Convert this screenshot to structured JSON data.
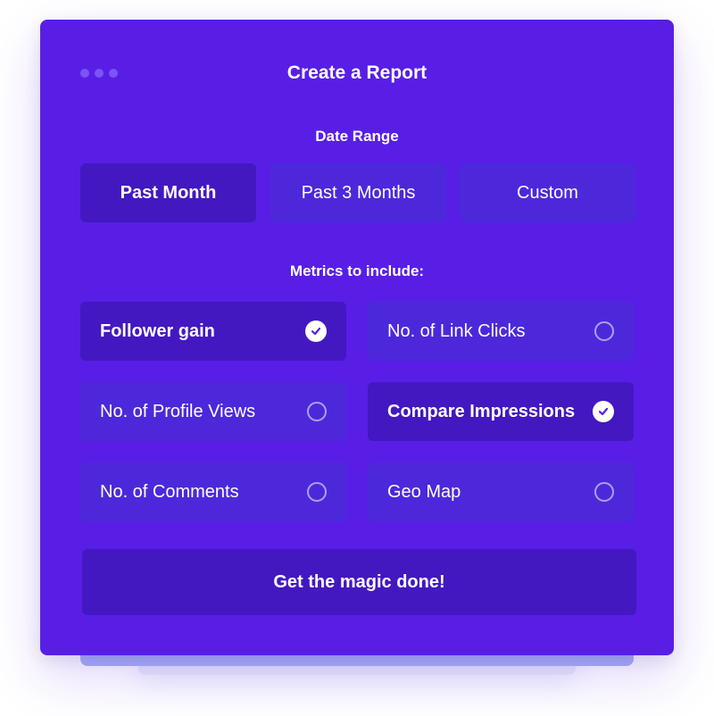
{
  "window": {
    "title": "Create a Report",
    "dots": 3
  },
  "date_range": {
    "label": "Date Range",
    "options": [
      {
        "label": "Past Month",
        "selected": true
      },
      {
        "label": "Past 3 Months",
        "selected": false
      },
      {
        "label": "Custom",
        "selected": false
      }
    ]
  },
  "metrics": {
    "label": "Metrics to include:",
    "items": [
      {
        "label": "Follower gain",
        "checked": true
      },
      {
        "label": "No. of Link Clicks",
        "checked": false
      },
      {
        "label": "No. of Profile Views",
        "checked": false
      },
      {
        "label": "Compare Impressions",
        "checked": true
      },
      {
        "label": "No. of Comments",
        "checked": false
      },
      {
        "label": "Geo Map",
        "checked": false
      }
    ]
  },
  "action": {
    "label": "Get the magic done!"
  },
  "colors": {
    "card": "#581ee6",
    "selected": "#4318c0",
    "unselected": "#4d28db",
    "check_mark": "#581ee6"
  }
}
